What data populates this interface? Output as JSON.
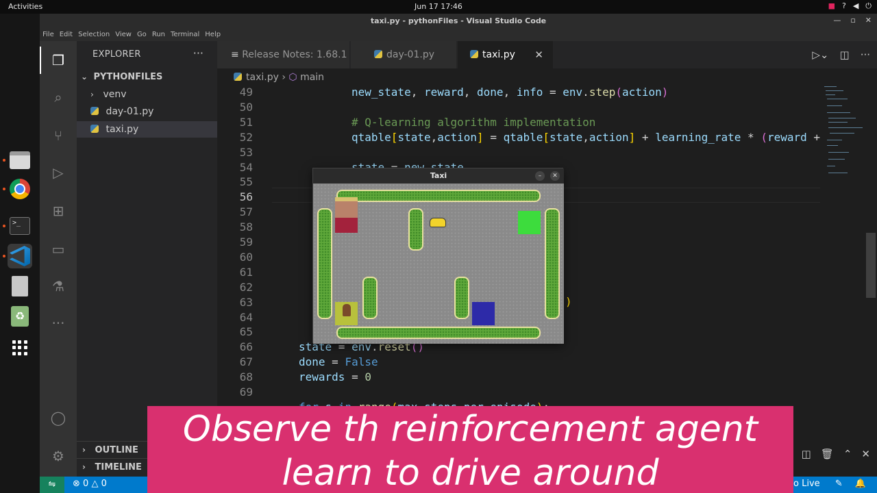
{
  "topbar": {
    "activities": "Activities",
    "clock": "Jun 17  17:46"
  },
  "window": {
    "title": "taxi.py - pythonFiles - Visual Studio Code"
  },
  "menu": [
    "File",
    "Edit",
    "Selection",
    "View",
    "Go",
    "Run",
    "Terminal",
    "Help"
  ],
  "sidebar": {
    "header": "EXPLORER",
    "more": "···",
    "folder": "PYTHONFILES",
    "items": [
      {
        "label": "venv",
        "type": "folder"
      },
      {
        "label": "day-01.py",
        "type": "file"
      },
      {
        "label": "taxi.py",
        "type": "file",
        "selected": true
      }
    ],
    "outline": "OUTLINE",
    "timeline": "TIMELINE"
  },
  "tabs": [
    {
      "label": "Release Notes: 1.68.1",
      "active": false
    },
    {
      "label": "day-01.py",
      "active": false
    },
    {
      "label": "taxi.py",
      "active": true
    }
  ],
  "breadcrumb": {
    "file": "taxi.py",
    "symbol": "main"
  },
  "code": {
    "line_numbers": [
      "49",
      "50",
      "51",
      "52",
      "53",
      "54",
      "55",
      "56",
      "57",
      "58",
      "59",
      "60",
      "61",
      "62",
      "63",
      "64",
      "65",
      "66",
      "67",
      "68",
      "69"
    ],
    "current_line": "56"
  },
  "taxi_window": {
    "title": "Taxi"
  },
  "status": {
    "errors": "0",
    "warnings": "0",
    "golive": "o Live"
  },
  "caption": {
    "line1": "Observe th reinforcement agent",
    "line2": "learn to drive around"
  }
}
